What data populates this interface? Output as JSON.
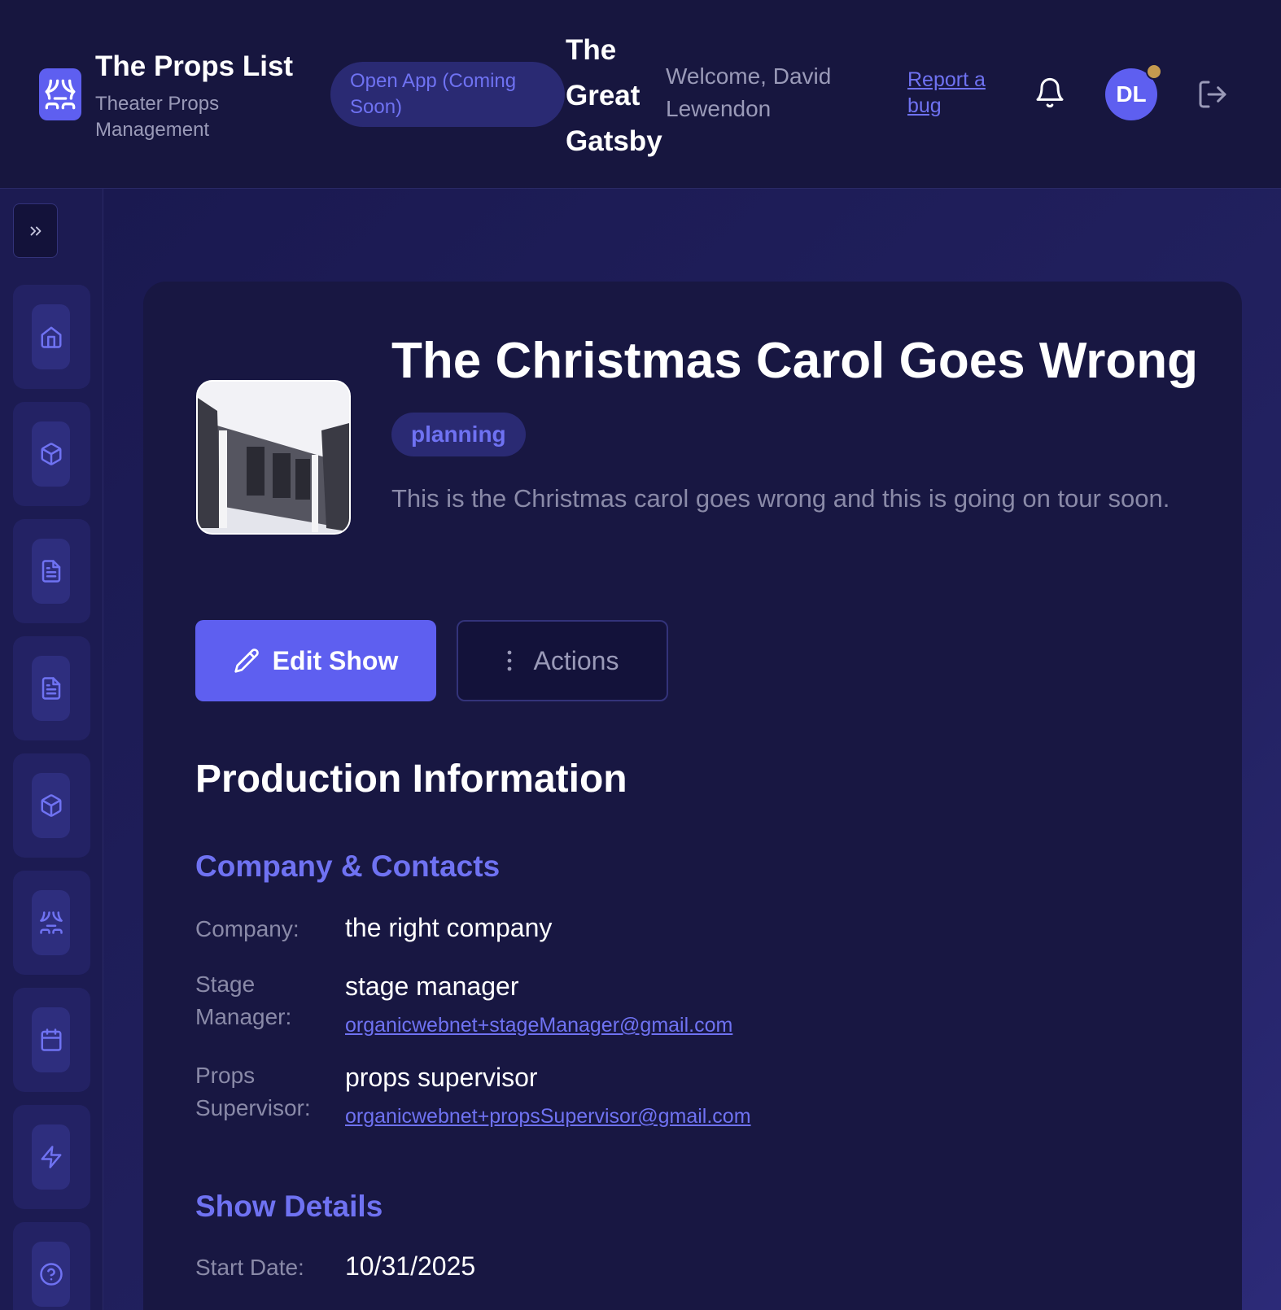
{
  "header": {
    "brand_title": "The Props List",
    "brand_subtitle": "Theater Props Management",
    "open_app_label": "Open App (Coming Soon)",
    "current_show": "The Great Gatsby",
    "welcome_text": "Welcome, David Lewendon",
    "report_bug_label": "Report a bug",
    "avatar_initials": "DL"
  },
  "sidebar": {
    "items": [
      {
        "icon": "home-icon"
      },
      {
        "icon": "box-icon"
      },
      {
        "icon": "document-icon"
      },
      {
        "icon": "document-icon"
      },
      {
        "icon": "box-icon"
      },
      {
        "icon": "theater-icon"
      },
      {
        "icon": "calendar-icon"
      },
      {
        "icon": "lightning-icon"
      },
      {
        "icon": "help-icon"
      }
    ]
  },
  "show": {
    "title": "The Christmas Carol Goes Wrong",
    "status": "planning",
    "description": "This is the Christmas carol goes wrong and this is going on tour soon.",
    "edit_label": "Edit Show",
    "actions_label": "Actions"
  },
  "production": {
    "section_title": "Production Information",
    "company_section_title": "Company & Contacts",
    "company_label": "Company:",
    "company_value": "the right company",
    "stage_manager_label": "Stage Manager:",
    "stage_manager_value": "stage manager",
    "stage_manager_email": "organicwebnet+stageManager@gmail.com",
    "props_supervisor_label": "Props Supervisor:",
    "props_supervisor_value": "props supervisor",
    "props_supervisor_email": "organicwebnet+propsSupervisor@gmail.com",
    "details_section_title": "Show Details",
    "start_date_label": "Start Date:",
    "start_date_value": "10/31/2025"
  },
  "colors": {
    "accent": "#5e5ff0",
    "accent_text": "#6f72f2",
    "background": "#1b1a4f",
    "card": "#181742",
    "notification_dot": "#c49a4f"
  }
}
